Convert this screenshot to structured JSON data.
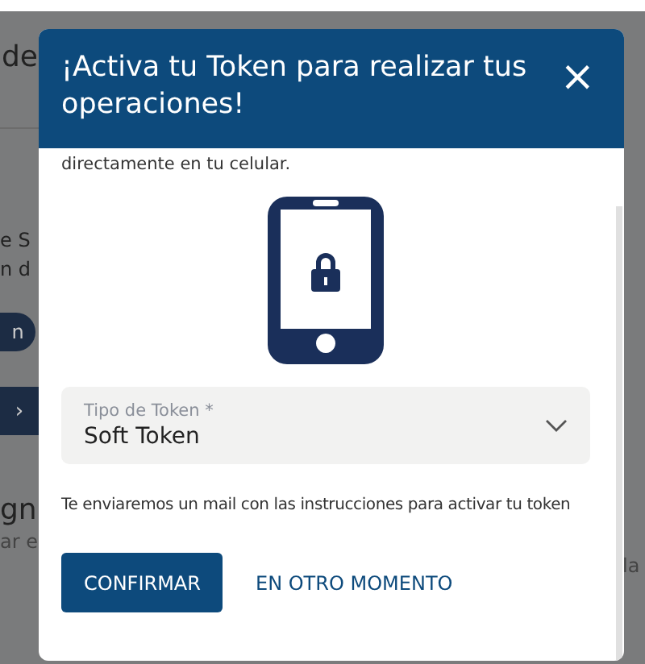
{
  "background": {
    "heading": "de",
    "lines": [
      "e S",
      "n d"
    ],
    "button": "n",
    "row_arrow": "›",
    "section_heading": "gn",
    "section_text": "ar e",
    "side_text": "la"
  },
  "modal": {
    "title": "¡Activa tu Token para realizar tus operaciones!",
    "close": "×",
    "intro": "directamente en tu celular.",
    "field": {
      "label": "Tipo de Token *",
      "value": "Soft Token"
    },
    "note": "Te enviaremos un mail con las instrucciones para activar tu token",
    "buttons": [
      {
        "label": "CONFIRMAR",
        "kind": "primary"
      },
      {
        "label": "EN OTRO MOMENTO",
        "kind": "link"
      }
    ]
  }
}
